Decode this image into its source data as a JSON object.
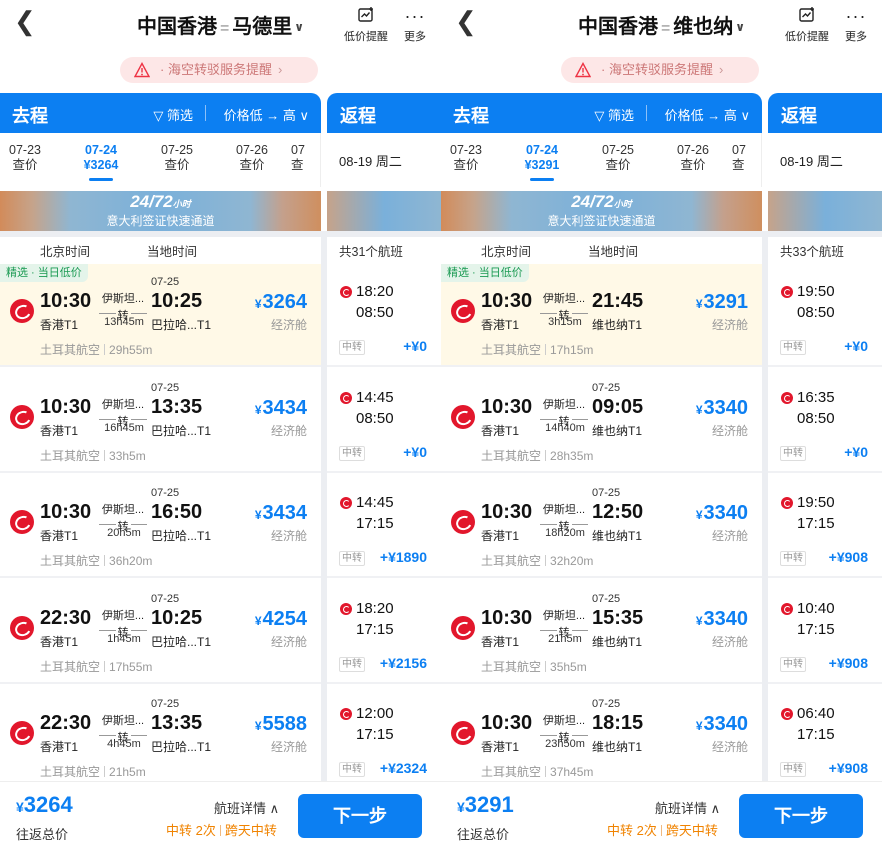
{
  "panels": [
    {
      "title_from": "中国香港",
      "title_sep": "=",
      "title_to": "马德里",
      "lowprice_label": "低价提醒",
      "more_label": "更多",
      "notice": "· 海空转驳服务提醒",
      "go_label": "去程",
      "filter_label": "筛选",
      "sort_label": "价格低 → 高",
      "return_label": "返程",
      "dates": [
        {
          "d": "07-23",
          "p": "查价"
        },
        {
          "d": "07-24",
          "p": "¥3264"
        },
        {
          "d": "07-25",
          "p": "查价"
        },
        {
          "d": "07-26",
          "p": "查价"
        },
        {
          "d": "07",
          "p": "查"
        }
      ],
      "return_date": "08-19 周二",
      "banner_main": "24/72",
      "banner_small": "小时",
      "banner_sub": "意大利签证快速通道",
      "col_bj": "北京时间",
      "col_local": "当地时间",
      "count_label": "共31个航班",
      "flights": [
        {
          "tag": "精选 · 当日低价",
          "dep": "10:30",
          "dep_ap": "香港T1",
          "via": "伊斯坦...",
          "transfer": "转",
          "dur": "13h45m",
          "next_day": "07-25",
          "arr": "10:25",
          "arr_ap": "巴拉哈...T1",
          "yen": "¥",
          "price": "3264",
          "cls": "经济舱",
          "airline": "土耳其航空",
          "total": "29h55m"
        },
        {
          "tag": "",
          "dep": "10:30",
          "dep_ap": "香港T1",
          "via": "伊斯坦...",
          "transfer": "转",
          "dur": "16h45m",
          "next_day": "07-25",
          "arr": "13:35",
          "arr_ap": "巴拉哈...T1",
          "yen": "¥",
          "price": "3434",
          "cls": "经济舱",
          "airline": "土耳其航空",
          "total": "33h5m"
        },
        {
          "tag": "",
          "dep": "10:30",
          "dep_ap": "香港T1",
          "via": "伊斯坦...",
          "transfer": "转",
          "dur": "20h5m",
          "next_day": "07-25",
          "arr": "16:50",
          "arr_ap": "巴拉哈...T1",
          "yen": "¥",
          "price": "3434",
          "cls": "经济舱",
          "airline": "土耳其航空",
          "total": "36h20m"
        },
        {
          "tag": "",
          "dep": "22:30",
          "dep_ap": "香港T1",
          "via": "伊斯坦...",
          "transfer": "转",
          "dur": "1h45m",
          "next_day": "07-25",
          "arr": "10:25",
          "arr_ap": "巴拉哈...T1",
          "yen": "¥",
          "price": "4254",
          "cls": "经济舱",
          "airline": "土耳其航空",
          "total": "17h55m"
        },
        {
          "tag": "",
          "dep": "22:30",
          "dep_ap": "香港T1",
          "via": "伊斯坦...",
          "transfer": "转",
          "dur": "4h45m",
          "next_day": "07-25",
          "arr": "13:35",
          "arr_ap": "巴拉哈...T1",
          "yen": "¥",
          "price": "5588",
          "cls": "经济舱",
          "airline": "土耳其航空",
          "total": "21h5m"
        }
      ],
      "returns": [
        {
          "t1": "18:20",
          "t2": "08:50",
          "zz": "中转",
          "rp": "+¥0"
        },
        {
          "t1": "14:45",
          "t2": "08:50",
          "zz": "中转",
          "rp": "+¥0"
        },
        {
          "t1": "14:45",
          "t2": "17:15",
          "zz": "中转",
          "rp": "+¥1890"
        },
        {
          "t1": "18:20",
          "t2": "17:15",
          "zz": "中转",
          "rp": "+¥2156"
        },
        {
          "t1": "12:00",
          "t2": "17:15",
          "zz": "中转",
          "rp": "+¥2324"
        }
      ],
      "footer": {
        "yen": "¥",
        "total": "3264",
        "total_label": "往返总价",
        "detail": "航班详情",
        "warn1": "中转 2次",
        "warn2": "跨天中转",
        "next": "下一步"
      }
    },
    {
      "title_from": "中国香港",
      "title_sep": "=",
      "title_to": "维也纳",
      "lowprice_label": "低价提醒",
      "more_label": "更多",
      "notice": "· 海空转驳服务提醒",
      "go_label": "去程",
      "filter_label": "筛选",
      "sort_label": "价格低 → 高",
      "return_label": "返程",
      "dates": [
        {
          "d": "07-23",
          "p": "查价"
        },
        {
          "d": "07-24",
          "p": "¥3291"
        },
        {
          "d": "07-25",
          "p": "查价"
        },
        {
          "d": "07-26",
          "p": "查价"
        },
        {
          "d": "07",
          "p": "查"
        }
      ],
      "return_date": "08-19 周二",
      "banner_main": "24/72",
      "banner_small": "小时",
      "banner_sub": "意大利签证快速通道",
      "col_bj": "北京时间",
      "col_local": "当地时间",
      "count_label": "共33个航班",
      "flights": [
        {
          "tag": "精选 · 当日低价",
          "dep": "10:30",
          "dep_ap": "香港T1",
          "via": "伊斯坦...",
          "transfer": "转",
          "dur": "3h15m",
          "next_day": "",
          "arr": "21:45",
          "arr_ap": "维也纳T1",
          "yen": "¥",
          "price": "3291",
          "cls": "经济舱",
          "airline": "土耳其航空",
          "total": "17h15m"
        },
        {
          "tag": "",
          "dep": "10:30",
          "dep_ap": "香港T1",
          "via": "伊斯坦...",
          "transfer": "转",
          "dur": "14h40m",
          "next_day": "07-25",
          "arr": "09:05",
          "arr_ap": "维也纳T1",
          "yen": "¥",
          "price": "3340",
          "cls": "经济舱",
          "airline": "土耳其航空",
          "total": "28h35m"
        },
        {
          "tag": "",
          "dep": "10:30",
          "dep_ap": "香港T1",
          "via": "伊斯坦...",
          "transfer": "转",
          "dur": "18h20m",
          "next_day": "07-25",
          "arr": "12:50",
          "arr_ap": "维也纳T1",
          "yen": "¥",
          "price": "3340",
          "cls": "经济舱",
          "airline": "土耳其航空",
          "total": "32h20m"
        },
        {
          "tag": "",
          "dep": "10:30",
          "dep_ap": "香港T1",
          "via": "伊斯坦...",
          "transfer": "转",
          "dur": "21h5m",
          "next_day": "07-25",
          "arr": "15:35",
          "arr_ap": "维也纳T1",
          "yen": "¥",
          "price": "3340",
          "cls": "经济舱",
          "airline": "土耳其航空",
          "total": "35h5m"
        },
        {
          "tag": "",
          "dep": "10:30",
          "dep_ap": "香港T1",
          "via": "伊斯坦...",
          "transfer": "转",
          "dur": "23h50m",
          "next_day": "07-25",
          "arr": "18:15",
          "arr_ap": "维也纳T1",
          "yen": "¥",
          "price": "3340",
          "cls": "经济舱",
          "airline": "土耳其航空",
          "total": "37h45m"
        }
      ],
      "returns": [
        {
          "t1": "19:50",
          "t2": "08:50",
          "zz": "中转",
          "rp": "+¥0"
        },
        {
          "t1": "16:35",
          "t2": "08:50",
          "zz": "中转",
          "rp": "+¥0"
        },
        {
          "t1": "19:50",
          "t2": "17:15",
          "zz": "中转",
          "rp": "+¥908"
        },
        {
          "t1": "10:40",
          "t2": "17:15",
          "zz": "中转",
          "rp": "+¥908"
        },
        {
          "t1": "06:40",
          "t2": "17:15",
          "zz": "中转",
          "rp": "+¥908"
        }
      ],
      "footer": {
        "yen": "¥",
        "total": "3291",
        "total_label": "往返总价",
        "detail": "航班详情",
        "warn1": "中转 2次",
        "warn2": "跨天中转",
        "next": "下一步"
      }
    }
  ]
}
